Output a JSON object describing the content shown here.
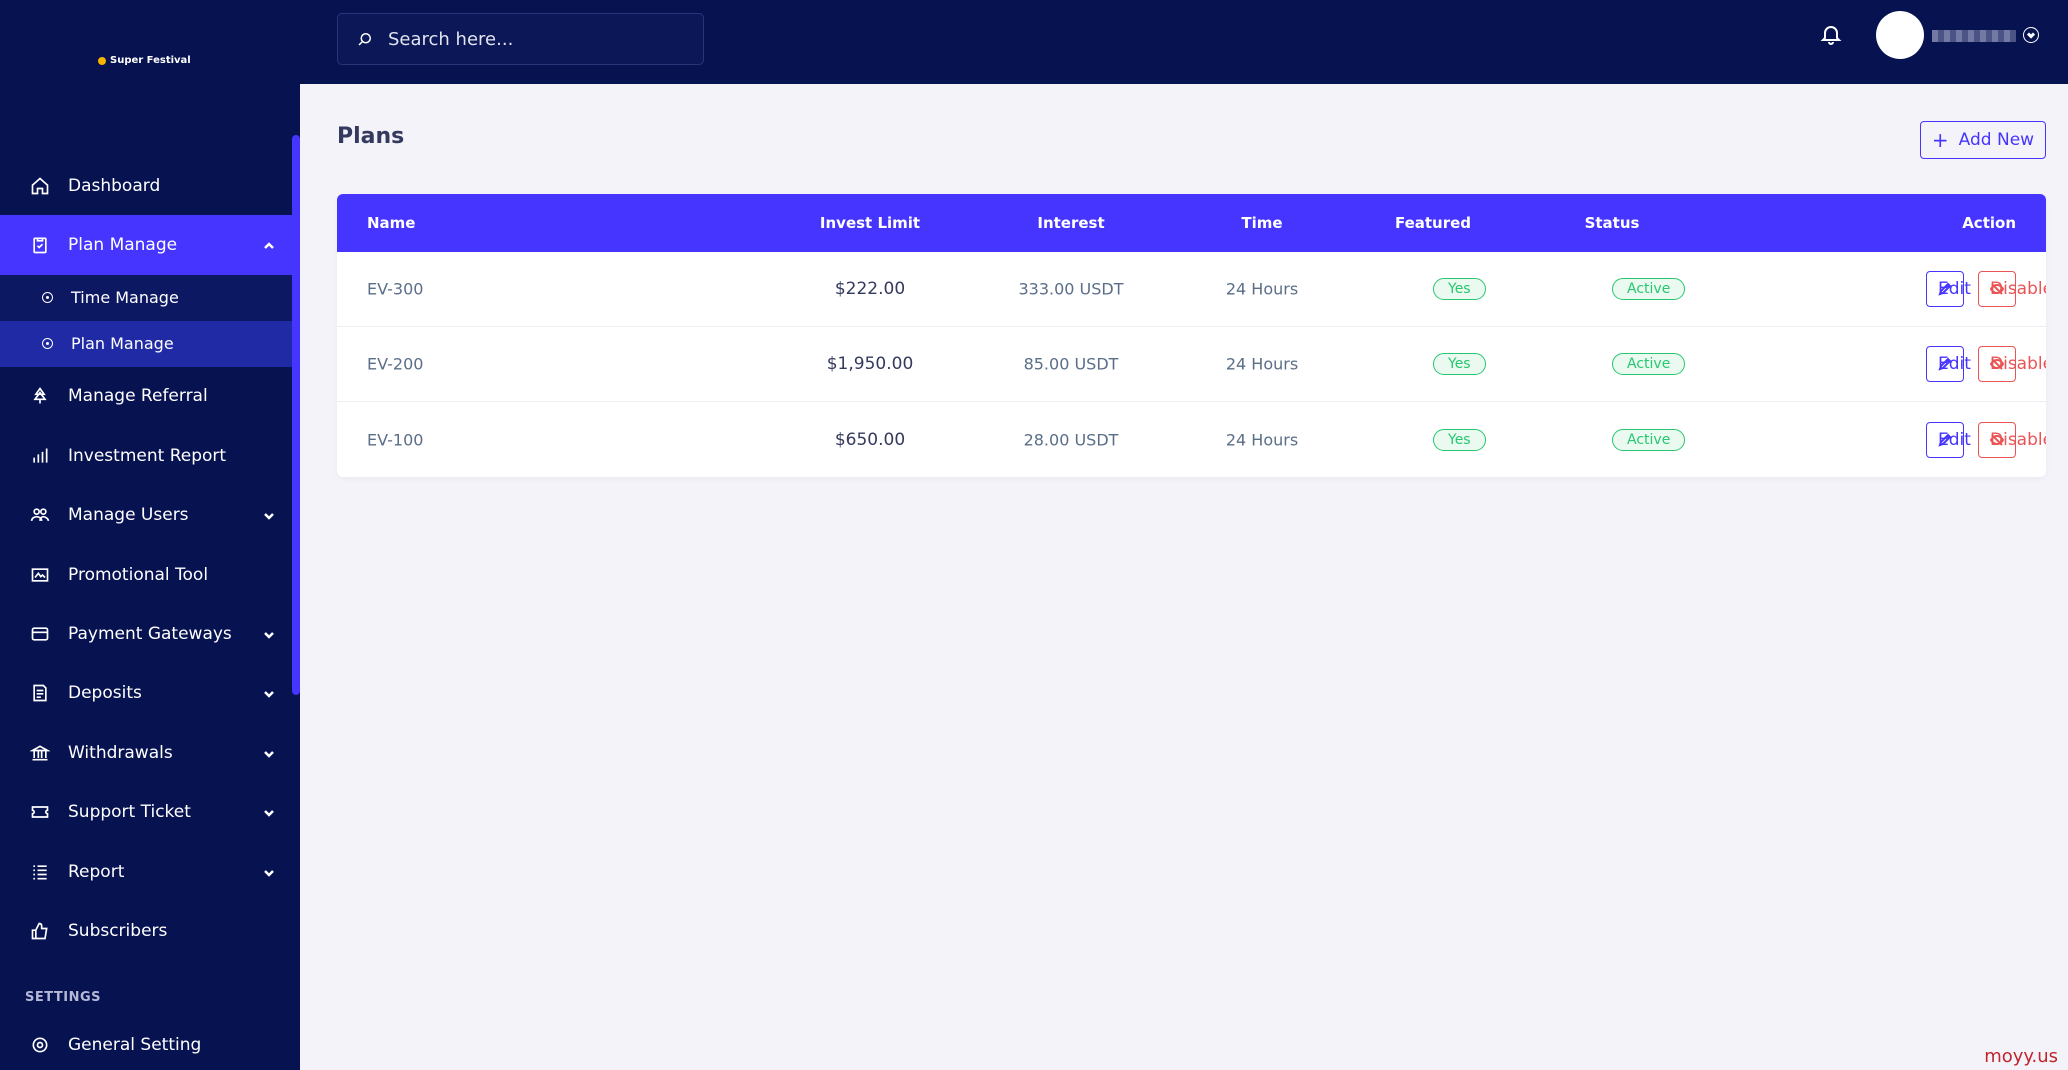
{
  "brand": {
    "logo_text": "Super Festival"
  },
  "sidebar": {
    "items": [
      {
        "label": "Dashboard",
        "icon": "home-icon"
      },
      {
        "label": "Plan Manage",
        "icon": "clipboard-icon",
        "expanded": true
      },
      {
        "label": "Manage Referral",
        "icon": "tree-icon"
      },
      {
        "label": "Investment Report",
        "icon": "bar-chart-icon"
      },
      {
        "label": "Manage Users",
        "icon": "users-icon"
      },
      {
        "label": "Promotional Tool",
        "icon": "image-icon"
      },
      {
        "label": "Payment Gateways",
        "icon": "credit-card-icon"
      },
      {
        "label": "Deposits",
        "icon": "receipt-icon"
      },
      {
        "label": "Withdrawals",
        "icon": "bank-icon"
      },
      {
        "label": "Support Ticket",
        "icon": "ticket-icon"
      },
      {
        "label": "Report",
        "icon": "list-icon"
      },
      {
        "label": "Subscribers",
        "icon": "thumbs-up-icon"
      }
    ],
    "sub_items": [
      {
        "label": "Time Manage"
      },
      {
        "label": "Plan Manage",
        "active": true
      }
    ],
    "settings_title": "SETTINGS",
    "general_setting": "General Setting"
  },
  "topbar": {
    "search_placeholder": "Search here..."
  },
  "page": {
    "title": "Plans",
    "add_new_label": "Add New"
  },
  "table": {
    "headers": {
      "name": "Name",
      "invest_limit": "Invest Limit",
      "interest": "Interest",
      "time": "Time",
      "featured": "Featured",
      "status": "Status",
      "action": "Action"
    },
    "rows": [
      {
        "name": "EV-300",
        "invest_limit": "$222.00",
        "interest": "333.00 USDT",
        "time": "24 Hours",
        "featured": "Yes",
        "status": "Active",
        "edit": "Edit",
        "disable": "Disable"
      },
      {
        "name": "EV-200",
        "invest_limit": "$1,950.00",
        "interest": "85.00 USDT",
        "time": "24 Hours",
        "featured": "Yes",
        "status": "Active",
        "edit": "Edit",
        "disable": "Disable"
      },
      {
        "name": "EV-100",
        "invest_limit": "$650.00",
        "interest": "28.00 USDT",
        "time": "24 Hours",
        "featured": "Yes",
        "status": "Active",
        "edit": "Edit",
        "disable": "Disable"
      }
    ]
  },
  "watermark": "moyy.us",
  "colors": {
    "sidebar_bg": "#071251",
    "accent": "#4634ff",
    "success": "#28c76f",
    "danger": "#ea5455"
  }
}
